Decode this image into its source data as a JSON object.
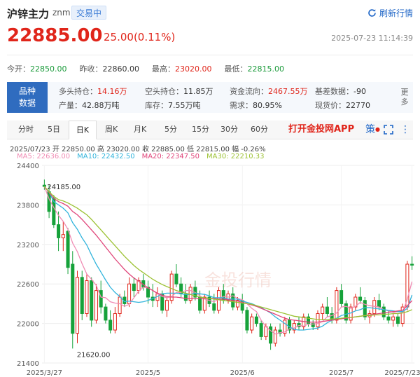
{
  "header": {
    "title": "沪锌主力",
    "code": "znm",
    "status": "交易中",
    "refresh_label": "刷新行情"
  },
  "price": {
    "last": "22885.00",
    "change": "25.00(0.11%)",
    "datetime": "2025-07-23 11:14:39"
  },
  "quote": [
    {
      "label": "今开：",
      "value": "22850.00",
      "color": "green"
    },
    {
      "label": "昨收：",
      "value": "22860.00",
      "color": "dark"
    },
    {
      "label": "最高：",
      "value": "23020.00",
      "color": "red"
    },
    {
      "label": "最低：",
      "value": "22815.00",
      "color": "green"
    }
  ],
  "info": {
    "tag_line1": "品种",
    "tag_line2": "数据",
    "cells": [
      {
        "label": "多头持仓：",
        "value": "14.16万",
        "color": "red"
      },
      {
        "label": "空头持仓：",
        "value": "11.85万",
        "color": "dark"
      },
      {
        "label": "资金流向：",
        "value": "2467.55万",
        "color": "red"
      },
      {
        "label": "基差数据：",
        "value": "-90",
        "color": "dark"
      },
      {
        "label": "产量：",
        "value": "42.88万吨",
        "color": "dark"
      },
      {
        "label": "库存：",
        "value": "7.55万吨",
        "color": "dark"
      },
      {
        "label": "需求：",
        "value": "80.95%",
        "color": "dark"
      },
      {
        "label": "现货价：",
        "value": "22770",
        "color": "dark"
      }
    ],
    "more_label": "更多"
  },
  "tabs": [
    "分时",
    "5日",
    "日K",
    "周K",
    "月K",
    "5分",
    "15分",
    "30分",
    "60分"
  ],
  "active_tab": "日K",
  "app_link": "打开金投网APP",
  "tools": {
    "strategy_label": "策"
  },
  "summary": "2025/07/23  开 22850.00  高 23020.00  收 22885.00  低 22815.00  幅 -0.26%",
  "ma": [
    {
      "label": "MA5: 22636.00",
      "color": "#f08cb4"
    },
    {
      "label": "MA10: 22432.50",
      "color": "#32b4dc"
    },
    {
      "label": "MA20: 22347.50",
      "color": "#e0457a"
    },
    {
      "label": "MA30: 22210.33",
      "color": "#9cc233"
    }
  ],
  "watermark": "金投行情",
  "chart_data": {
    "type": "candlestick",
    "y_ticks": [
      24400,
      23800,
      23200,
      22600,
      22000,
      21400
    ],
    "ylim": [
      21400,
      24400
    ],
    "x_ticks": [
      {
        "label": "2025/3/27",
        "index": 0
      },
      {
        "label": "2025/5",
        "index": 22
      },
      {
        "label": "2025/6",
        "index": 42
      },
      {
        "label": "2025/7",
        "index": 63
      },
      {
        "label": "2025/7/23",
        "index": 78
      }
    ],
    "high_label": "24185.00",
    "low_label": "21620.00",
    "up_color": "#e0251a",
    "down_color": "#16a23a",
    "candles": [
      [
        24100,
        24185,
        24030,
        24080
      ],
      [
        24000,
        24100,
        23600,
        23700
      ],
      [
        23900,
        23950,
        23450,
        23500
      ],
      [
        23500,
        23700,
        23100,
        23300
      ],
      [
        23300,
        23550,
        23100,
        23350
      ],
      [
        23400,
        23450,
        22750,
        22850
      ],
      [
        22900,
        23100,
        21620,
        21850
      ],
      [
        21850,
        22800,
        21700,
        22700
      ],
      [
        22700,
        22800,
        22050,
        22150
      ],
      [
        22150,
        22750,
        22100,
        22650
      ],
      [
        22650,
        22700,
        21950,
        22050
      ],
      [
        22050,
        22600,
        22000,
        22500
      ],
      [
        22500,
        22650,
        22150,
        22250
      ],
      [
        22250,
        22300,
        22000,
        22050
      ],
      [
        22050,
        22200,
        21850,
        21900
      ],
      [
        21900,
        22250,
        21850,
        22150
      ],
      [
        22150,
        22450,
        22100,
        22400
      ],
      [
        22400,
        22500,
        22250,
        22300
      ],
      [
        22300,
        22700,
        22250,
        22600
      ],
      [
        22600,
        22700,
        22400,
        22500
      ],
      [
        22500,
        22700,
        22450,
        22650
      ],
      [
        22650,
        22750,
        22500,
        22550
      ],
      [
        22550,
        22650,
        22300,
        22400
      ],
      [
        22400,
        22600,
        22250,
        22350
      ],
      [
        22350,
        22550,
        22250,
        22450
      ],
      [
        22450,
        22500,
        22150,
        22200
      ],
      [
        22200,
        22400,
        22100,
        22350
      ],
      [
        22350,
        22800,
        22300,
        22750
      ],
      [
        22750,
        22900,
        22550,
        22600
      ],
      [
        22600,
        22700,
        22400,
        22450
      ],
      [
        22450,
        22600,
        22300,
        22350
      ],
      [
        22350,
        22600,
        22300,
        22550
      ],
      [
        22550,
        22650,
        22350,
        22400
      ],
      [
        22400,
        22500,
        22150,
        22200
      ],
      [
        22200,
        22450,
        22150,
        22400
      ],
      [
        22400,
        22500,
        22250,
        22300
      ],
      [
        22300,
        22450,
        22150,
        22200
      ],
      [
        22200,
        22550,
        22150,
        22500
      ],
      [
        22500,
        22600,
        22300,
        22350
      ],
      [
        22350,
        22500,
        22300,
        22450
      ],
      [
        22450,
        22550,
        22200,
        22250
      ],
      [
        22250,
        22400,
        22200,
        22350
      ],
      [
        22350,
        22450,
        22150,
        22200
      ],
      [
        22200,
        22250,
        21850,
        21900
      ],
      [
        21900,
        22150,
        21850,
        22100
      ],
      [
        22100,
        22150,
        21950,
        22000
      ],
      [
        22000,
        22050,
        21750,
        21800
      ],
      [
        21800,
        22000,
        21750,
        21950
      ],
      [
        21950,
        22000,
        21600,
        21700
      ],
      [
        21700,
        21950,
        21650,
        21900
      ],
      [
        21900,
        22000,
        21800,
        21850
      ],
      [
        21850,
        22100,
        21800,
        22050
      ],
      [
        22050,
        22100,
        21850,
        21900
      ],
      [
        21900,
        22050,
        21850,
        22000
      ],
      [
        22000,
        22100,
        21900,
        21950
      ],
      [
        21950,
        22150,
        21900,
        22100
      ],
      [
        22100,
        22150,
        21950,
        22000
      ],
      [
        22000,
        22050,
        21900,
        21950
      ],
      [
        21950,
        22200,
        21900,
        22150
      ],
      [
        22150,
        22300,
        22050,
        22250
      ],
      [
        22250,
        22400,
        22100,
        22150
      ],
      [
        22150,
        22250,
        22000,
        22050
      ],
      [
        22050,
        22550,
        22000,
        22500
      ],
      [
        22500,
        22600,
        22250,
        22300
      ],
      [
        22300,
        22350,
        22000,
        22050
      ],
      [
        22050,
        22300,
        22000,
        22250
      ],
      [
        22250,
        22450,
        22200,
        22400
      ],
      [
        22400,
        22550,
        22300,
        22350
      ],
      [
        22350,
        22400,
        22050,
        22100
      ],
      [
        22100,
        22200,
        22000,
        22150
      ],
      [
        22150,
        22400,
        22100,
        22350
      ],
      [
        22350,
        22450,
        22200,
        22250
      ],
      [
        22250,
        22300,
        22050,
        22100
      ],
      [
        22100,
        22200,
        22000,
        22050
      ],
      [
        22050,
        22150,
        21950,
        22100
      ],
      [
        22100,
        22150,
        21950,
        22000
      ],
      [
        22000,
        22300,
        21950,
        22250
      ],
      [
        22250,
        22950,
        22200,
        22900
      ],
      [
        22900,
        23020,
        22815,
        22885
      ]
    ],
    "ma_lines": [
      {
        "name": "MA5",
        "color": "#f08cb4",
        "values": [
          24080,
          23890,
          23760,
          23640,
          23550,
          23430,
          23220,
          23090,
          22910,
          22750,
          22670,
          22580,
          22400,
          22390,
          22330,
          22310,
          22300,
          22260,
          22290,
          22390,
          22490,
          22550,
          22540,
          22500,
          22450,
          22410,
          22390,
          22410,
          22470,
          22470,
          22500,
          22500,
          22470,
          22420,
          22370,
          22350,
          22330,
          22370,
          22410,
          22400,
          22420,
          22380,
          22360,
          22300,
          22230,
          22180,
          22050,
          21950,
          21890,
          21840,
          21860,
          21870,
          21920,
          21930,
          21970,
          21960,
          21990,
          21990,
          22000,
          22030,
          22100,
          22120,
          22160,
          22250,
          22260,
          22230,
          22260,
          22320,
          22290,
          22270,
          22260,
          22250,
          22210,
          22190,
          22170,
          22150,
          22170,
          22370,
          22636
        ]
      },
      {
        "name": "MA10",
        "color": "#32b4dc",
        "values": [
          24080,
          23990,
          23850,
          23800,
          23750,
          23680,
          23530,
          23430,
          23300,
          23190,
          23040,
          22900,
          22780,
          22660,
          22550,
          22470,
          22410,
          22330,
          22340,
          22330,
          22320,
          22330,
          22350,
          22380,
          22410,
          22450,
          22460,
          22460,
          22460,
          22450,
          22440,
          22440,
          22460,
          22450,
          22440,
          22420,
          22390,
          22390,
          22390,
          22370,
          22370,
          22370,
          22340,
          22320,
          22300,
          22270,
          22240,
          22200,
          22160,
          22100,
          22050,
          22000,
          21950,
          21910,
          21900,
          21900,
          21910,
          21920,
          21930,
          21960,
          22010,
          22050,
          22080,
          22120,
          22140,
          22160,
          22190,
          22210,
          22240,
          22240,
          22230,
          22220,
          22210,
          22200,
          22190,
          22180,
          22180,
          22230,
          22432
        ]
      },
      {
        "name": "MA20",
        "color": "#e0457a",
        "values": [
          24080,
          23990,
          23900,
          23850,
          23820,
          23780,
          23700,
          23650,
          23580,
          23500,
          23420,
          23340,
          23250,
          23160,
          23070,
          22980,
          22900,
          22820,
          22750,
          22690,
          22640,
          22590,
          22540,
          22500,
          22460,
          22430,
          22410,
          22400,
          22400,
          22390,
          22380,
          22380,
          22380,
          22380,
          22380,
          22380,
          22380,
          22370,
          22370,
          22360,
          22350,
          22340,
          22320,
          22300,
          22280,
          22260,
          22230,
          22200,
          22170,
          22140,
          22110,
          22080,
          22060,
          22050,
          22040,
          22030,
          22020,
          22020,
          22020,
          22030,
          22040,
          22050,
          22060,
          22070,
          22080,
          22090,
          22100,
          22110,
          22120,
          22130,
          22140,
          22150,
          22160,
          22170,
          22180,
          22190,
          22200,
          22270,
          22347
        ]
      },
      {
        "name": "MA30",
        "color": "#9cc233",
        "values": [
          24080,
          24000,
          23930,
          23880,
          23860,
          23830,
          23790,
          23750,
          23700,
          23650,
          23580,
          23500,
          23420,
          23340,
          23260,
          23180,
          23100,
          23020,
          22950,
          22880,
          22820,
          22770,
          22720,
          22670,
          22630,
          22590,
          22560,
          22530,
          22500,
          22480,
          22460,
          22440,
          22420,
          22400,
          22390,
          22380,
          22370,
          22360,
          22350,
          22340,
          22330,
          22320,
          22310,
          22300,
          22290,
          22270,
          22250,
          22230,
          22210,
          22190,
          22170,
          22150,
          22130,
          22110,
          22100,
          22090,
          22080,
          22070,
          22060,
          22060,
          22060,
          22070,
          22070,
          22080,
          22090,
          22090,
          22100,
          22110,
          22120,
          22120,
          22130,
          22130,
          22140,
          22140,
          22150,
          22150,
          22160,
          22180,
          22210
        ]
      }
    ]
  }
}
